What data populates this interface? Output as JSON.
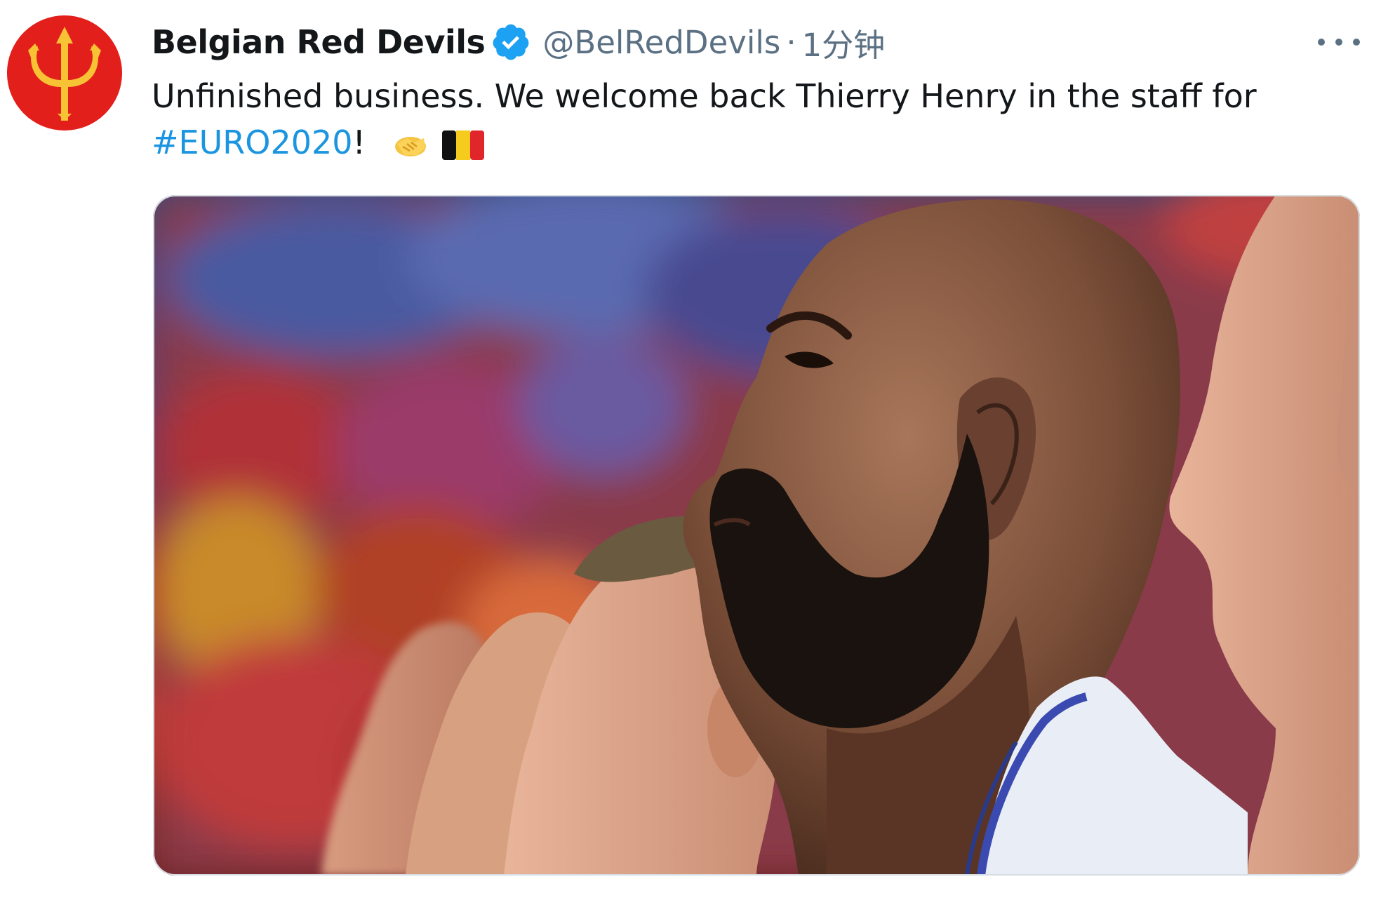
{
  "tweet": {
    "author": {
      "display_name": "Belgian Red Devils",
      "handle": "@BelRedDevils",
      "verified": true,
      "avatar_icon": "red-devils-trident-logo"
    },
    "separator": "·",
    "time_ago": "1分钟",
    "text_line1": "Unfinished business. We welcome back Thierry Henry in the staff for",
    "hashtag": "#EURO2020",
    "text_after_hashtag": "!",
    "emojis": [
      "handshake-emoji",
      "belgium-flag-emoji"
    ],
    "more_icon": "more-options-icon",
    "colors": {
      "text": "#14171a",
      "secondary": "#5b7083",
      "hashtag": "#1b95e0",
      "verified": "#1da1f2",
      "avatar_red": "#e31f1c",
      "avatar_gold": "#f7c234"
    }
  }
}
